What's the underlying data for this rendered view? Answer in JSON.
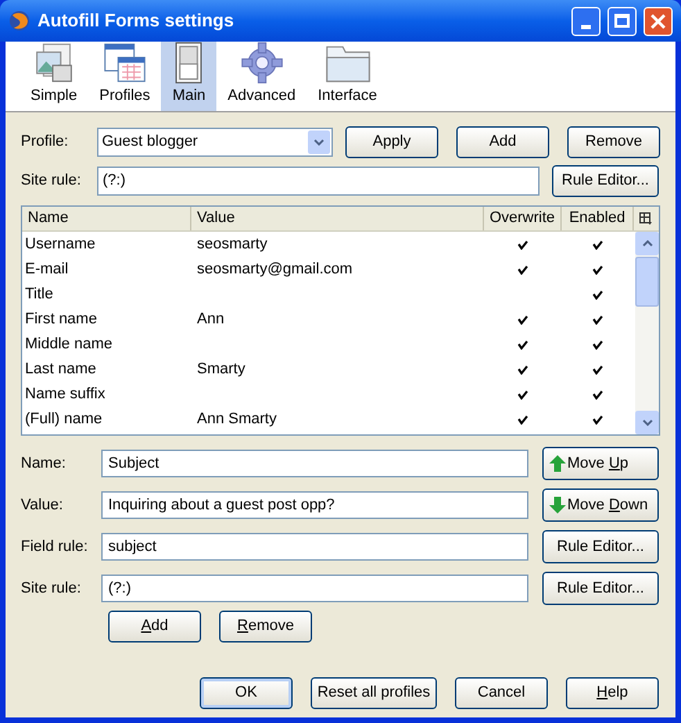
{
  "window": {
    "title": "Autofill Forms settings"
  },
  "toolbar": [
    {
      "label": "Simple",
      "kind": "simple",
      "selected": false
    },
    {
      "label": "Profiles",
      "kind": "profiles",
      "selected": false
    },
    {
      "label": "Main",
      "kind": "main",
      "selected": true
    },
    {
      "label": "Advanced",
      "kind": "advanced",
      "selected": false
    },
    {
      "label": "Interface",
      "kind": "interface",
      "selected": false
    }
  ],
  "profile": {
    "label": "Profile:",
    "value": "Guest blogger",
    "buttons": [
      "Apply",
      "Add",
      "Remove"
    ]
  },
  "site_rule": {
    "label": "Site rule:",
    "value": "(?:)",
    "button": "Rule Editor..."
  },
  "table": {
    "columns": [
      "Name",
      "Value",
      "Overwrite",
      "Enabled"
    ],
    "rows": [
      {
        "name": "Username",
        "value": "seosmarty",
        "overwrite": true,
        "enabled": true
      },
      {
        "name": "E-mail",
        "value": "seosmarty@gmail.com",
        "overwrite": true,
        "enabled": true
      },
      {
        "name": "Title",
        "overwrite": false,
        "enabled": true
      },
      {
        "name": "First name",
        "value": "Ann",
        "overwrite": true,
        "enabled": true
      },
      {
        "name": "Middle name",
        "overwrite": true,
        "enabled": true
      },
      {
        "name": "Last name",
        "value": "Smarty",
        "overwrite": true,
        "enabled": true
      },
      {
        "name": "Name suffix",
        "overwrite": true,
        "enabled": true
      },
      {
        "name": "(Full) name",
        "value": "Ann Smarty",
        "overwrite": true,
        "enabled": true
      }
    ]
  },
  "fields": [
    {
      "label": "Name:",
      "value": "Subject",
      "button": {
        "kind": "up",
        "before": "Move ",
        "key": "U",
        "after": "p"
      }
    },
    {
      "label": "Value:",
      "value": "Inquiring about a guest post opp?",
      "button": {
        "kind": "down",
        "before": "Move ",
        "key": "D",
        "after": "own"
      }
    },
    {
      "label": "Field rule:",
      "value": "subject",
      "button": {
        "kind": "plain",
        "before": "Rule Editor..."
      }
    },
    {
      "label": "Site rule:",
      "value": "(?:)",
      "button": {
        "kind": "plain",
        "before": "Rule Editor..."
      }
    }
  ],
  "entry_buttons": [
    {
      "key": "A",
      "after": "dd"
    },
    {
      "key": "R",
      "after": "emove"
    }
  ],
  "footer_buttons": [
    {
      "before": "OK",
      "default": true
    },
    {
      "before": "Reset all profiles",
      "default": false
    },
    {
      "before": "Cancel",
      "default": false
    },
    {
      "key": "H",
      "after": "elp",
      "default": false
    }
  ]
}
